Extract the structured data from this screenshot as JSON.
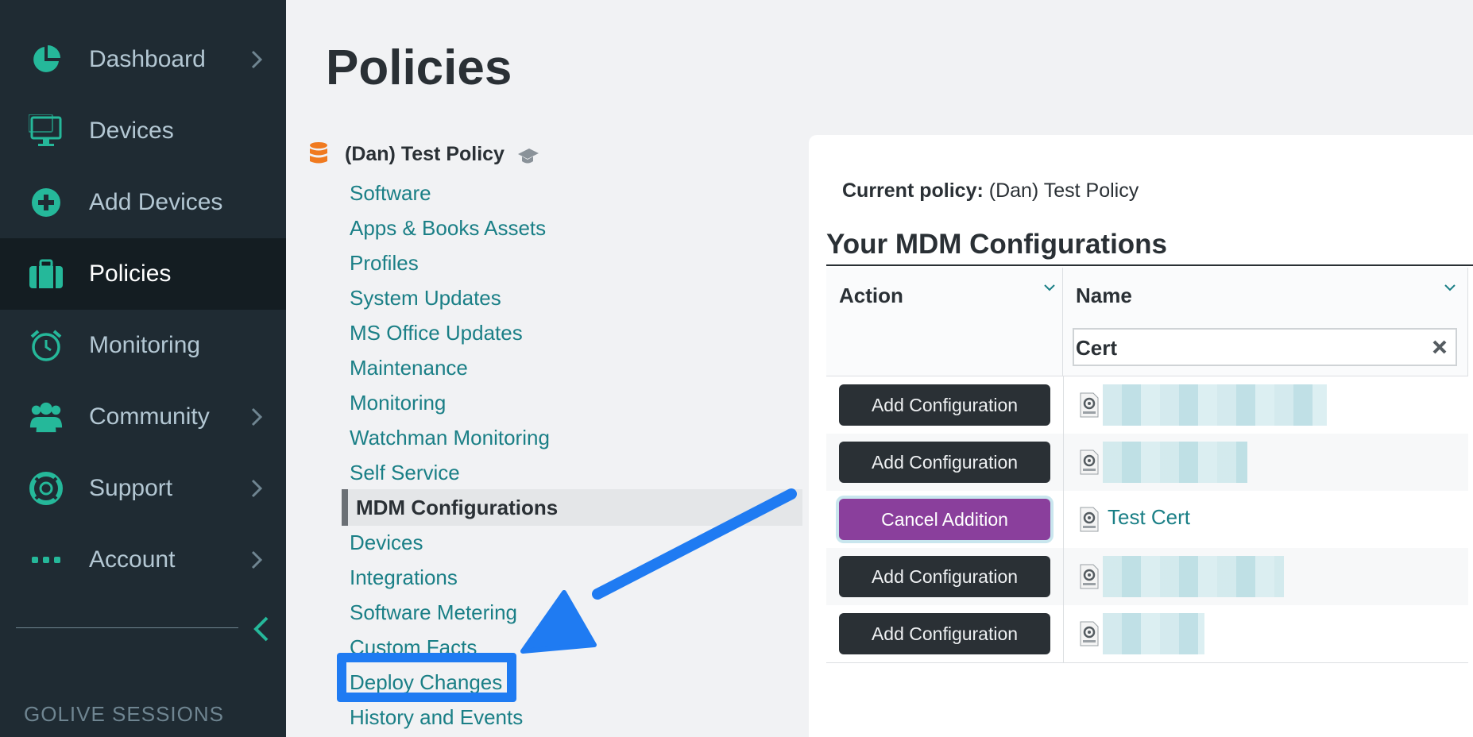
{
  "sidebar": {
    "items": [
      {
        "label": "Dashboard",
        "icon": "pie-chart-icon",
        "chevron": true,
        "active": false
      },
      {
        "label": "Devices",
        "icon": "monitor-icon",
        "chevron": false,
        "active": false
      },
      {
        "label": "Add Devices",
        "icon": "plus-circle-icon",
        "chevron": false,
        "active": false
      },
      {
        "label": "Policies",
        "icon": "briefcase-icon",
        "chevron": false,
        "active": true
      },
      {
        "label": "Monitoring",
        "icon": "alarm-clock-icon",
        "chevron": false,
        "active": false
      },
      {
        "label": "Community",
        "icon": "people-icon",
        "chevron": true,
        "active": false
      },
      {
        "label": "Support",
        "icon": "lifebuoy-icon",
        "chevron": true,
        "active": false
      },
      {
        "label": "Account",
        "icon": "more-dots-icon",
        "chevron": true,
        "active": false
      }
    ],
    "footer_label": "GOLIVE SESSIONS"
  },
  "page": {
    "title": "Policies"
  },
  "policy": {
    "name": "(Dan) Test Policy",
    "menu": [
      "Software",
      "Apps & Books Assets",
      "Profiles",
      "System Updates",
      "MS Office Updates",
      "Maintenance",
      "Monitoring",
      "Watchman Monitoring",
      "Self Service",
      "MDM Configurations",
      "Devices",
      "Integrations",
      "Software Metering",
      "Custom Facts",
      "Deploy Changes",
      "History and Events"
    ],
    "active_menu": "MDM Configurations",
    "highlighted_menu": "Deploy Changes"
  },
  "panel": {
    "current_policy_label": "Current policy:",
    "current_policy_value": "(Dan) Test Policy",
    "section_title": "Your MDM Configurations",
    "columns": {
      "action": "Action",
      "name": "Name"
    },
    "filter_value": "Cert",
    "rows": [
      {
        "action": "Add Configuration",
        "name": "",
        "state": "add"
      },
      {
        "action": "Add Configuration",
        "name": "",
        "state": "add"
      },
      {
        "action": "Cancel Addition",
        "name": "Test Cert",
        "state": "cancel"
      },
      {
        "action": "Add Configuration",
        "name": "",
        "state": "add"
      },
      {
        "action": "Add Configuration",
        "name": "",
        "state": "add"
      }
    ]
  },
  "colors": {
    "sidebar_bg": "#1f2b33",
    "accent_teal": "#25b89a",
    "link": "#1a7f86",
    "cancel_purple": "#8a3f9c",
    "annotation_blue": "#1f7bf2"
  }
}
